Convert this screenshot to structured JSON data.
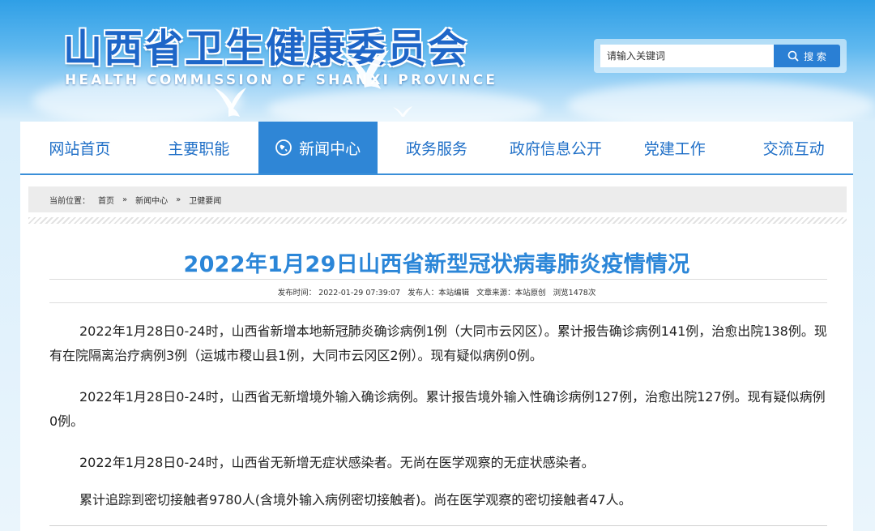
{
  "header": {
    "title": "山西省卫生健康委员会",
    "subtitle": "HEALTH COMMISSION OF SHANXI PROVINCE"
  },
  "search": {
    "placeholder": "请输入关键词",
    "button_label": "搜 索"
  },
  "nav": {
    "items": [
      {
        "label": "网站首页"
      },
      {
        "label": "主要职能"
      },
      {
        "label": "新闻中心"
      },
      {
        "label": "政务服务"
      },
      {
        "label": "政府信息公开"
      },
      {
        "label": "党建工作"
      },
      {
        "label": "交流互动"
      }
    ],
    "active_index": 2
  },
  "breadcrumb": {
    "prefix": "当前位置：",
    "items": [
      "首页",
      "新闻中心",
      "卫健要闻"
    ],
    "separator": "»"
  },
  "article": {
    "title": "2022年1月29日山西省新型冠状病毒肺炎疫情情况",
    "meta": {
      "publish_time": "发布时间： 2022-01-29 07:39:07",
      "publisher": "发布人：本站编辑",
      "source": "文章来源：本站原创",
      "views": "浏览1478次"
    },
    "paragraphs": [
      "2022年1月28日0-24时，山西省新增本地新冠肺炎确诊病例1例（大同市云冈区）。累计报告确诊病例141例，治愈出院138例。现有在院隔离治疗病例3例（运城市稷山县1例，大同市云冈区2例）。现有疑似病例0例。",
      "2022年1月28日0-24时，山西省无新增境外输入确诊病例。累计报告境外输入性确诊病例127例，治愈出院127例。现有疑似病例0例。",
      "2022年1月28日0-24时，山西省无新增无症状感染者。无尚在医学观察的无症状感染者。",
      "累计追踪到密切接触者9780人(含境外输入病例密切接触者)。尚在医学观察的密切接触者47人。"
    ]
  },
  "colors": {
    "brand_blue": "#2f86d6",
    "title_blue": "#2b86d8",
    "nav_text": "#1f6fc7"
  }
}
